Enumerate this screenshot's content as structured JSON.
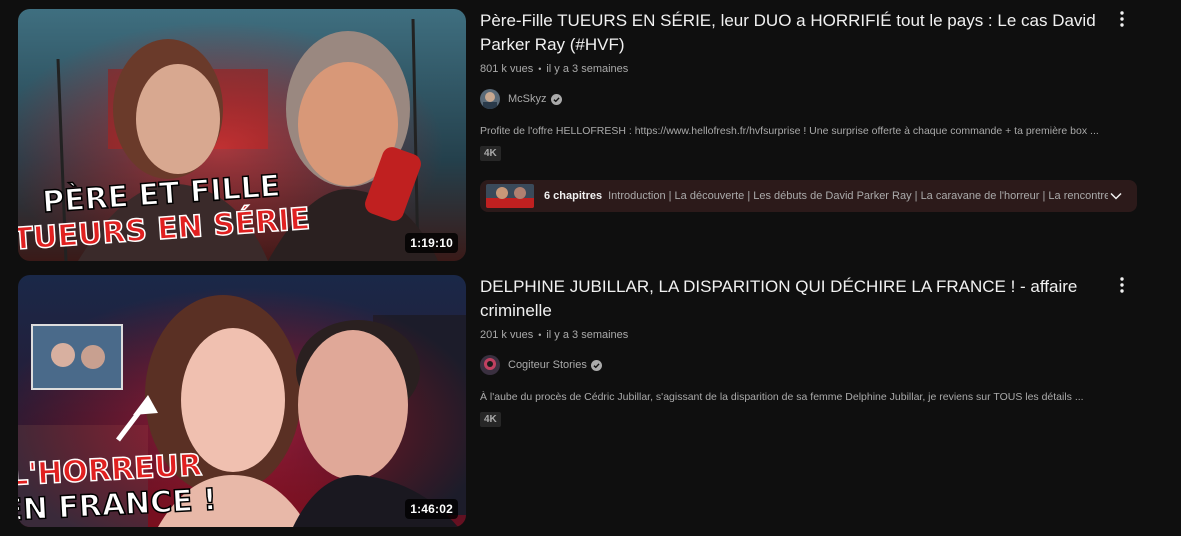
{
  "videos": [
    {
      "title": "Père-Fille TUEURS EN SÉRIE, leur DUO a HORRIFIÉ tout le pays : Le cas David Parker Ray (#HVF)",
      "views": "801 k vues",
      "age": "il y a 3 semaines",
      "channel": "McSkyz",
      "description": "Profite de l'offre HELLOFRESH : https://www.hellofresh.fr/hvfsurprise ! Une surprise offerte à chaque commande + ta première box ...",
      "badge": "4K",
      "duration": "1:19:10",
      "thumbnail_text": [
        "PÈRE ET FILLE",
        "TUEURS EN SÉRIE"
      ],
      "chapters": {
        "count": "6 chapitres",
        "list": "Introduction | La découverte | Les débuts de David Parker Ray | La caravane de l'horreur | La rencontre..."
      }
    },
    {
      "title": "DELPHINE JUBILLAR, LA DISPARITION QUI DÉCHIRE LA FRANCE ! - affaire criminelle",
      "views": "201 k vues",
      "age": "il y a 3 semaines",
      "channel": "Cogiteur Stories",
      "description": "À l'aube du procès de Cédric Jubillar, s'agissant de la disparition de sa femme Delphine Jubillar, je reviens sur TOUS les détails ...",
      "badge": "4K",
      "duration": "1:46:02",
      "thumbnail_text": [
        "L'HORREUR",
        "EN FRANCE !"
      ]
    }
  ],
  "colors": {
    "background": "#0f0f0f",
    "title": "#f1f1f1",
    "secondary": "#aaaaaa",
    "chapters_bg": "#2c1a1a",
    "accent_red": "#e02020"
  },
  "icons": [
    "more-vert-icon",
    "verified-icon",
    "chevron-down-icon"
  ]
}
